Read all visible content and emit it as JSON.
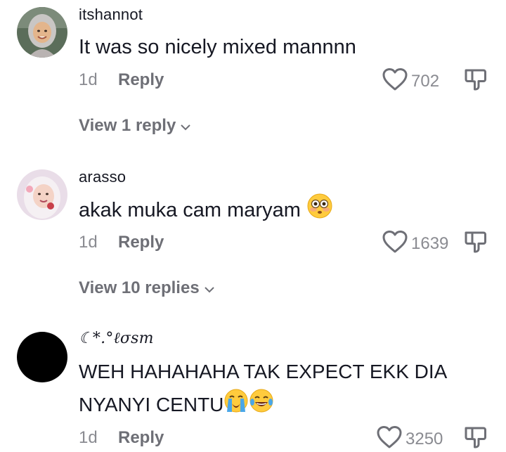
{
  "comments": [
    {
      "username": "itshannot",
      "text": "It was so nicely mixed mannnn",
      "time": "1d",
      "reply_label": "Reply",
      "likes": "702",
      "view_replies": "View 1 reply"
    },
    {
      "username": "arasso",
      "text": "akak muka cam maryam",
      "time": "1d",
      "reply_label": "Reply",
      "likes": "1639",
      "view_replies": "View 10 replies"
    },
    {
      "username": "☾*.°ℓσѕт",
      "text_line1": "WEH HAHAHAHA TAK EXPECT EKK DIA",
      "text_line2": "NYANYI CENTU",
      "time": "1d",
      "reply_label": "Reply",
      "likes": "3250"
    }
  ],
  "icons": {
    "like": "heart-outline-icon",
    "dislike": "thumbs-down-icon",
    "expand": "chevron-down-icon",
    "emoji_1": "flushed-face-emoji",
    "emoji_2": "loudly-crying-face-emoji",
    "emoji_3": "tears-of-joy-emoji"
  },
  "colors": {
    "text_primary": "#161823",
    "text_secondary": "#8a8b91",
    "reply_text": "#6e6f76"
  }
}
